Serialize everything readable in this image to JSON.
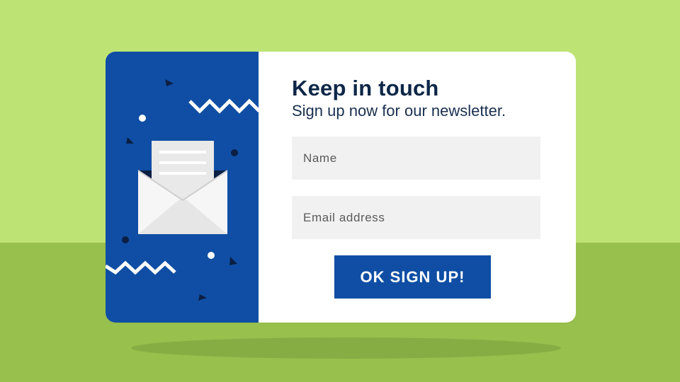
{
  "popup": {
    "title": "Keep in touch",
    "subtitle": "Sign up now for our newsletter.",
    "name_placeholder": "Name",
    "email_placeholder": "Email address",
    "button_label": "OK SIGN UP!"
  },
  "icons": {
    "illustration": "envelope-with-letter-icon",
    "decorations": [
      "zigzag",
      "dot",
      "triangle"
    ]
  },
  "colors": {
    "background_top": "#bde374",
    "background_bottom": "#97c04d",
    "panel_blue": "#0f4ea4",
    "title_navy": "#0e2748",
    "field_gray": "#f1f1f1",
    "card_white": "#ffffff"
  }
}
